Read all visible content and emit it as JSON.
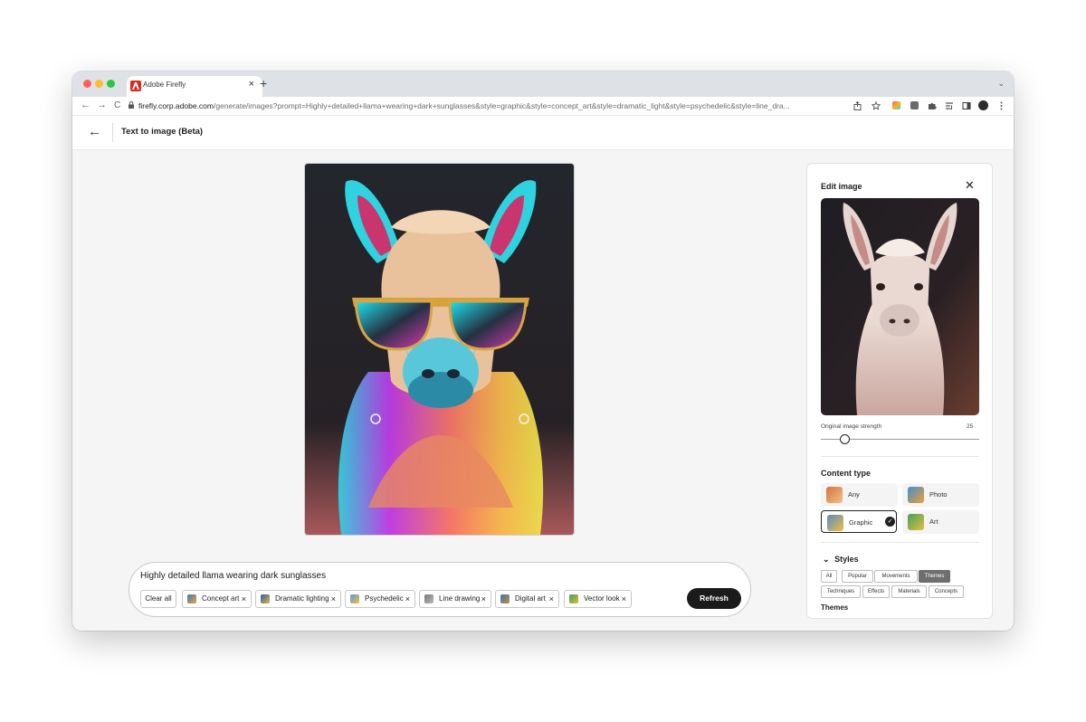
{
  "browser": {
    "tab_title": "Adobe Firefly",
    "tab_close": "×",
    "new_tab": "+",
    "tabs_menu": "⌄",
    "nav": {
      "back": "←",
      "forward": "→",
      "reload": "C"
    },
    "url_host": "firefly.corp.adobe.com",
    "url_path": "/generate/images?prompt=Highly+detailed+llama+wearing+dark+sunglasses&style=graphic&style=concept_art&style=dramatic_light&style=psychedelic&style=line_dra...",
    "extension_icons": [
      "share-icon",
      "star-icon",
      "color-extension-icon",
      "z-extension-icon",
      "puzzle-icon",
      "reading-list-icon",
      "sidepanel-icon",
      "profile-avatar-icon",
      "more-icon"
    ]
  },
  "header": {
    "back_glyph": "←",
    "title": "Text to image (Beta)"
  },
  "prompt": {
    "text": "Highly detailed llama wearing dark sunglasses",
    "clear_all": "Clear all",
    "chips": [
      {
        "label": "Concept art"
      },
      {
        "label": "Dramatic lighting"
      },
      {
        "label": "Psychedelic"
      },
      {
        "label": "Line drawing"
      },
      {
        "label": "Digital art"
      },
      {
        "label": "Vector look"
      }
    ],
    "chip_remove": "×",
    "refresh": "Refresh"
  },
  "panel": {
    "title": "Edit image",
    "close": "✕",
    "strength_label": "Original image strength",
    "strength_value": "25",
    "strength_fraction": 0.25,
    "content_type_title": "Content type",
    "content_types": [
      {
        "label": "Any",
        "selected": false
      },
      {
        "label": "Photo",
        "selected": false
      },
      {
        "label": "Graphic",
        "selected": true
      },
      {
        "label": "Art",
        "selected": false
      }
    ],
    "check": "✓",
    "styles_title": "Styles",
    "styles_chevron": "⌄",
    "style_filters": [
      "All",
      "Popular",
      "Movements",
      "Themes",
      "Techniques",
      "Effects",
      "Materials",
      "Concepts"
    ],
    "active_style_filter": "Themes",
    "themes_label": "Themes"
  },
  "colors": {
    "accent_button": "#1b1b1b",
    "active_filter": "#6e6e6e",
    "close_red": "#ff5f57",
    "min_yellow": "#febc2e",
    "max_green": "#28c840"
  }
}
